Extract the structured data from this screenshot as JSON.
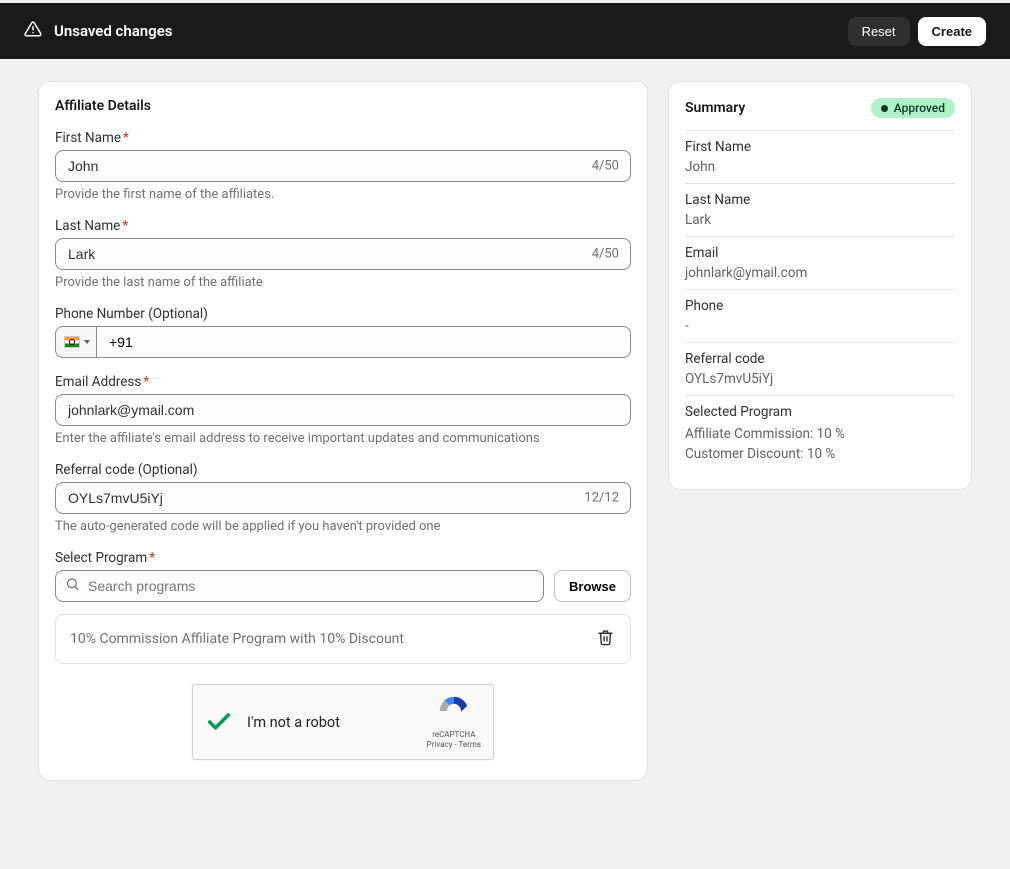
{
  "topbar": {
    "title": "Unsaved changes",
    "reset": "Reset",
    "create": "Create"
  },
  "main": {
    "title": "Affiliate Details",
    "firstName": {
      "label": "First Name",
      "value": "John",
      "counter": "4/50",
      "helper": "Provide the first name of the affiliates."
    },
    "lastName": {
      "label": "Last Name",
      "value": "Lark",
      "counter": "4/50",
      "helper": "Provide the last name of the affiliate"
    },
    "phone": {
      "label": "Phone Number (Optional)",
      "prefix": "+91"
    },
    "email": {
      "label": "Email Address",
      "value": "johnlark@ymail.com",
      "helper": "Enter the affiliate's email address to receive important updates and communications"
    },
    "referral": {
      "label": "Referral code (Optional)",
      "value": "OYLs7mvU5iYj",
      "counter": "12/12",
      "helper": "The auto-generated code will be applied if you haven't provided one"
    },
    "program": {
      "label": "Select Program",
      "placeholder": "Search programs",
      "browse": "Browse",
      "selected": "10% Commission Affiliate Program with 10% Discount"
    },
    "recaptcha": {
      "label": "I'm not a robot",
      "brand": "reCAPTCHA",
      "links": "Privacy - Terms"
    }
  },
  "summary": {
    "title": "Summary",
    "status": "Approved",
    "rows": {
      "firstName": {
        "label": "First Name",
        "value": "John"
      },
      "lastName": {
        "label": "Last Name",
        "value": "Lark"
      },
      "email": {
        "label": "Email",
        "value": "johnlark@ymail.com"
      },
      "phone": {
        "label": "Phone",
        "value": "-"
      },
      "referral": {
        "label": "Referral code",
        "value": "OYLs7mvU5iYj"
      },
      "program": {
        "label": "Selected Program",
        "line1": "Affiliate Commission: 10 %",
        "line2": "Customer Discount: 10 %"
      }
    }
  }
}
